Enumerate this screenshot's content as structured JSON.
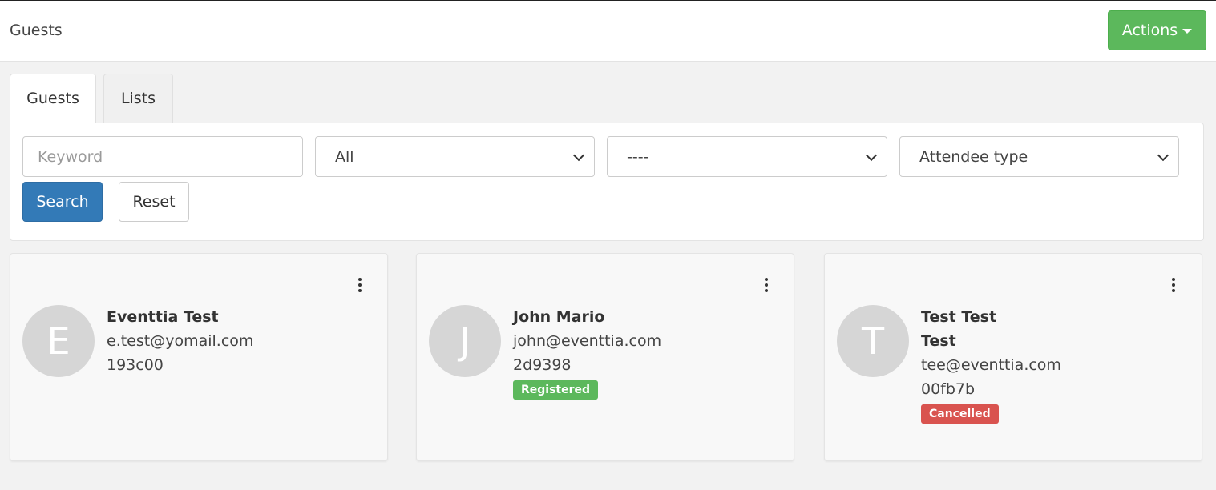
{
  "header": {
    "title": "Guests",
    "actions_label": "Actions",
    "actions_color": "#5cb85c"
  },
  "tabs": [
    {
      "label": "Guests",
      "active": true
    },
    {
      "label": "Lists",
      "active": false
    }
  ],
  "filters": {
    "keyword_placeholder": "Keyword",
    "keyword_value": "",
    "status_select": "All",
    "secondary_select": "----",
    "attendee_type_select": "Attendee type",
    "search_label": "Search",
    "reset_label": "Reset",
    "search_color": "#337ab7"
  },
  "guests": [
    {
      "initial": "E",
      "name": "Eventtia Test",
      "name2": "",
      "email": "e.test@yomail.com",
      "code": "193c00",
      "status": "",
      "status_color": ""
    },
    {
      "initial": "J",
      "name": "John Mario",
      "name2": "",
      "email": "john@eventtia.com",
      "code": "2d9398",
      "status": "Registered",
      "status_color": "#5cb85c"
    },
    {
      "initial": "T",
      "name": "Test Test",
      "name2": "Test",
      "email": "tee@eventtia.com",
      "code": "00fb7b",
      "status": "Cancelled",
      "status_color": "#d9534f"
    }
  ]
}
